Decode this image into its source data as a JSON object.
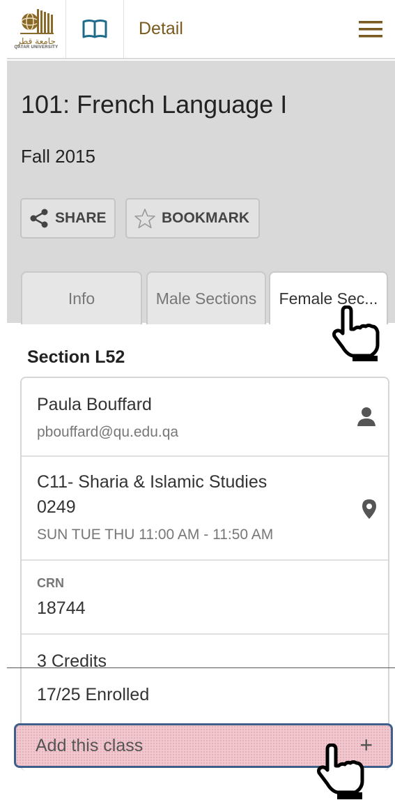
{
  "header": {
    "logo": {
      "arabic_text": "جامعة قطر",
      "english_text": "QATAR UNIVERSITY",
      "icon": "qatar-university-logo"
    },
    "book_icon": "book-icon",
    "title": "Detail",
    "menu_icon": "hamburger-menu-icon"
  },
  "course": {
    "title": "101: French Language I",
    "term": "Fall 2015",
    "actions": {
      "share_label": "SHARE",
      "bookmark_label": "BOOKMARK"
    }
  },
  "tabs": [
    {
      "label": "Info",
      "selected": false
    },
    {
      "label": "Male Sections",
      "selected": false
    },
    {
      "label": "Female Sec...",
      "selected": true
    }
  ],
  "section": {
    "heading": "Section L52",
    "instructor_name": "Paula Bouffard",
    "instructor_email": "pbouffard@qu.edu.qa",
    "location_line1": "C11- Sharia & Islamic Studies",
    "location_line2": "0249",
    "schedule": "SUN TUE THU 11:00 AM - 11:50 AM",
    "crn_label": "CRN",
    "crn_value": "18744",
    "credits": "3 Credits",
    "enrolled": "17/25 Enrolled",
    "add_label": "Add this class",
    "add_icon": "+"
  },
  "colors": {
    "header_title": "#7a5a1e",
    "course_background": "#d9d9d9",
    "add_button_border": "#3d5f8a",
    "add_button_fill": "#efc9cf"
  }
}
